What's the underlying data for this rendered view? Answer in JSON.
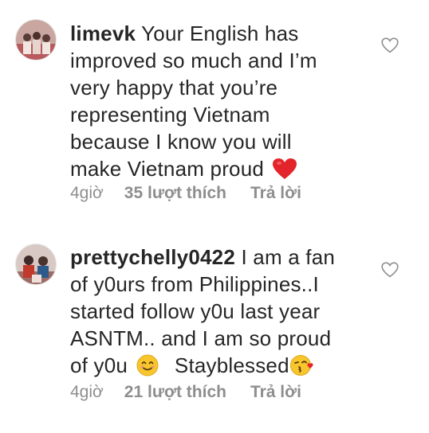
{
  "comments": [
    {
      "username": "limevk",
      "text_lines": [
        "Your English has",
        "improved so much and I’m",
        "very happy that you’re",
        "representing Vietnam",
        "because I know you will",
        "make Vietnam proud"
      ],
      "emoji": "red-heart",
      "time": "4giờ",
      "likes": "35 lượt thích",
      "reply": "Trả lời"
    },
    {
      "username": "prettychelly0422",
      "text_lines": [
        "I am a fan",
        "of y0urs from Philippines..I",
        "started follow y0u last year",
        "ASNTM.. and I am so proud",
        "of y0u",
        "Stayblessed"
      ],
      "emoji_1": "smiling-face",
      "emoji_2": "face-blowing-kiss",
      "time": "4giờ",
      "likes": "21 lượt thích",
      "reply": "Trả lời"
    }
  ],
  "colors": {
    "text": "#262626",
    "meta": "#8e8e8e",
    "heart_red": "#e3242b"
  }
}
